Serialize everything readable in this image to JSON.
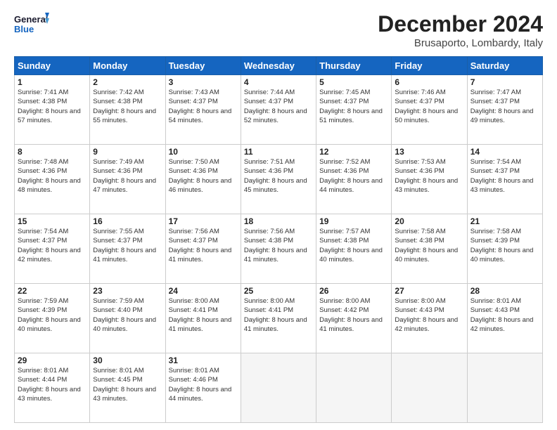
{
  "logo": {
    "line1": "General",
    "line2": "Blue"
  },
  "title": "December 2024",
  "subtitle": "Brusaporto, Lombardy, Italy",
  "weekdays": [
    "Sunday",
    "Monday",
    "Tuesday",
    "Wednesday",
    "Thursday",
    "Friday",
    "Saturday"
  ],
  "weeks": [
    [
      {
        "day": "1",
        "sunrise": "7:41 AM",
        "sunset": "4:38 PM",
        "daylight": "8 hours and 57 minutes."
      },
      {
        "day": "2",
        "sunrise": "7:42 AM",
        "sunset": "4:38 PM",
        "daylight": "8 hours and 55 minutes."
      },
      {
        "day": "3",
        "sunrise": "7:43 AM",
        "sunset": "4:37 PM",
        "daylight": "8 hours and 54 minutes."
      },
      {
        "day": "4",
        "sunrise": "7:44 AM",
        "sunset": "4:37 PM",
        "daylight": "8 hours and 52 minutes."
      },
      {
        "day": "5",
        "sunrise": "7:45 AM",
        "sunset": "4:37 PM",
        "daylight": "8 hours and 51 minutes."
      },
      {
        "day": "6",
        "sunrise": "7:46 AM",
        "sunset": "4:37 PM",
        "daylight": "8 hours and 50 minutes."
      },
      {
        "day": "7",
        "sunrise": "7:47 AM",
        "sunset": "4:37 PM",
        "daylight": "8 hours and 49 minutes."
      }
    ],
    [
      {
        "day": "8",
        "sunrise": "7:48 AM",
        "sunset": "4:36 PM",
        "daylight": "8 hours and 48 minutes."
      },
      {
        "day": "9",
        "sunrise": "7:49 AM",
        "sunset": "4:36 PM",
        "daylight": "8 hours and 47 minutes."
      },
      {
        "day": "10",
        "sunrise": "7:50 AM",
        "sunset": "4:36 PM",
        "daylight": "8 hours and 46 minutes."
      },
      {
        "day": "11",
        "sunrise": "7:51 AM",
        "sunset": "4:36 PM",
        "daylight": "8 hours and 45 minutes."
      },
      {
        "day": "12",
        "sunrise": "7:52 AM",
        "sunset": "4:36 PM",
        "daylight": "8 hours and 44 minutes."
      },
      {
        "day": "13",
        "sunrise": "7:53 AM",
        "sunset": "4:36 PM",
        "daylight": "8 hours and 43 minutes."
      },
      {
        "day": "14",
        "sunrise": "7:54 AM",
        "sunset": "4:37 PM",
        "daylight": "8 hours and 43 minutes."
      }
    ],
    [
      {
        "day": "15",
        "sunrise": "7:54 AM",
        "sunset": "4:37 PM",
        "daylight": "8 hours and 42 minutes."
      },
      {
        "day": "16",
        "sunrise": "7:55 AM",
        "sunset": "4:37 PM",
        "daylight": "8 hours and 41 minutes."
      },
      {
        "day": "17",
        "sunrise": "7:56 AM",
        "sunset": "4:37 PM",
        "daylight": "8 hours and 41 minutes."
      },
      {
        "day": "18",
        "sunrise": "7:56 AM",
        "sunset": "4:38 PM",
        "daylight": "8 hours and 41 minutes."
      },
      {
        "day": "19",
        "sunrise": "7:57 AM",
        "sunset": "4:38 PM",
        "daylight": "8 hours and 40 minutes."
      },
      {
        "day": "20",
        "sunrise": "7:58 AM",
        "sunset": "4:38 PM",
        "daylight": "8 hours and 40 minutes."
      },
      {
        "day": "21",
        "sunrise": "7:58 AM",
        "sunset": "4:39 PM",
        "daylight": "8 hours and 40 minutes."
      }
    ],
    [
      {
        "day": "22",
        "sunrise": "7:59 AM",
        "sunset": "4:39 PM",
        "daylight": "8 hours and 40 minutes."
      },
      {
        "day": "23",
        "sunrise": "7:59 AM",
        "sunset": "4:40 PM",
        "daylight": "8 hours and 40 minutes."
      },
      {
        "day": "24",
        "sunrise": "8:00 AM",
        "sunset": "4:41 PM",
        "daylight": "8 hours and 41 minutes."
      },
      {
        "day": "25",
        "sunrise": "8:00 AM",
        "sunset": "4:41 PM",
        "daylight": "8 hours and 41 minutes."
      },
      {
        "day": "26",
        "sunrise": "8:00 AM",
        "sunset": "4:42 PM",
        "daylight": "8 hours and 41 minutes."
      },
      {
        "day": "27",
        "sunrise": "8:00 AM",
        "sunset": "4:43 PM",
        "daylight": "8 hours and 42 minutes."
      },
      {
        "day": "28",
        "sunrise": "8:01 AM",
        "sunset": "4:43 PM",
        "daylight": "8 hours and 42 minutes."
      }
    ],
    [
      {
        "day": "29",
        "sunrise": "8:01 AM",
        "sunset": "4:44 PM",
        "daylight": "8 hours and 43 minutes."
      },
      {
        "day": "30",
        "sunrise": "8:01 AM",
        "sunset": "4:45 PM",
        "daylight": "8 hours and 43 minutes."
      },
      {
        "day": "31",
        "sunrise": "8:01 AM",
        "sunset": "4:46 PM",
        "daylight": "8 hours and 44 minutes."
      },
      null,
      null,
      null,
      null
    ]
  ]
}
